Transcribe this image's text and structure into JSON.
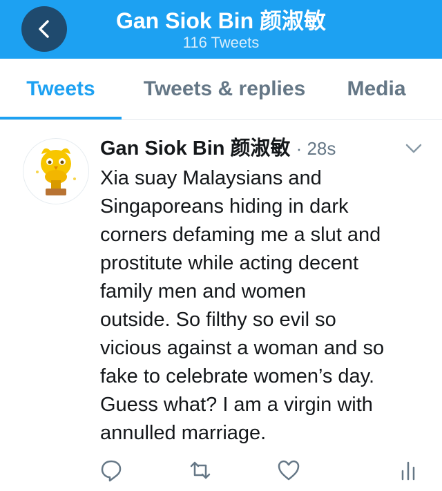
{
  "header": {
    "title": "Gan Siok Bin 颜淑敏",
    "subtitle": "116 Tweets"
  },
  "tabs": [
    {
      "label": "Tweets",
      "active": true
    },
    {
      "label": "Tweets & replies",
      "active": false
    },
    {
      "label": "Media",
      "active": false
    }
  ],
  "tweet": {
    "author": "Gan Siok Bin 颜淑敏",
    "time": "· 28s",
    "lines": [
      "Xia suay Malaysians and",
      "Singaporeans hiding in dark",
      "corners defaming me a slut and",
      "prostitute while acting decent",
      "family men and  women",
      "outside. So filthy so evil so",
      "vicious against a woman and so",
      "fake to celebrate women’s day.",
      "Guess what? I am a virgin with",
      "annulled marriage."
    ]
  },
  "colors": {
    "brand": "#1da1f2",
    "back_button": "#1f4a6e",
    "text_primary": "#14171a",
    "text_secondary": "#657786"
  },
  "icons": {
    "back": "chevron-left-icon",
    "more": "chevron-down-icon",
    "reply": "reply-icon",
    "retweet": "retweet-icon",
    "like": "heart-icon",
    "analytics": "analytics-icon",
    "avatar": "owl-trophy-avatar"
  }
}
